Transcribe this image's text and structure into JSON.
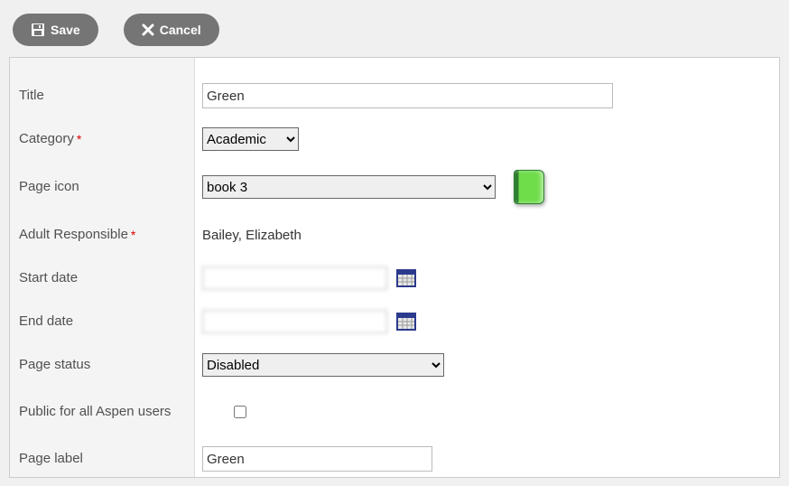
{
  "toolbar": {
    "save_label": "Save",
    "cancel_label": "Cancel"
  },
  "labels": {
    "title": "Title",
    "category": "Category",
    "page_icon": "Page icon",
    "adult_responsible": "Adult Responsible",
    "start_date": "Start date",
    "end_date": "End date",
    "page_status": "Page status",
    "public_all": "Public for all Aspen users",
    "page_label": "Page label"
  },
  "required_mark": "*",
  "fields": {
    "title": "Green",
    "category": "Academic",
    "page_icon": "book 3",
    "adult_responsible": "Bailey, Elizabeth",
    "start_date": "",
    "end_date": "",
    "page_status": "Disabled",
    "public_all": false,
    "page_label": "Green"
  }
}
